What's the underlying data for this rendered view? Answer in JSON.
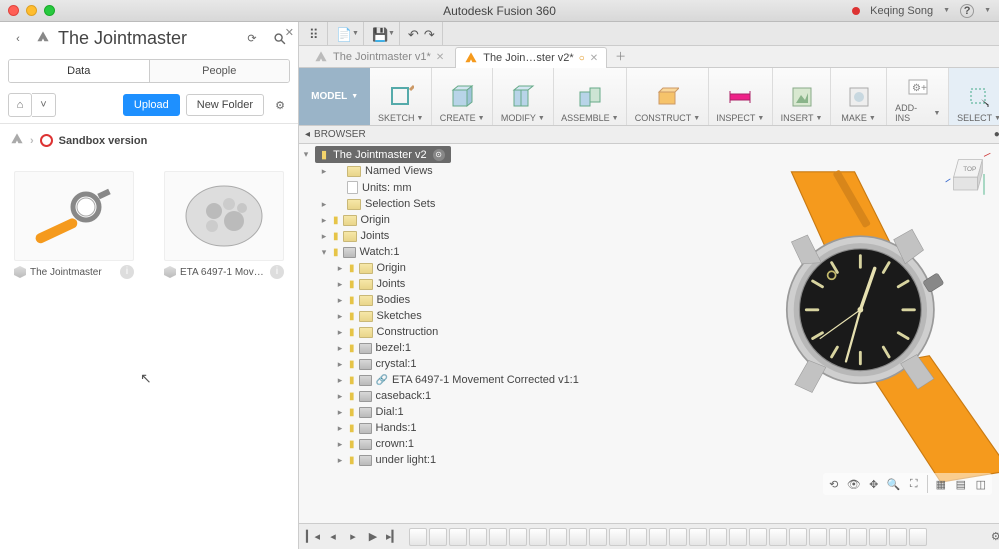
{
  "app_title": "Autodesk Fusion 360",
  "user_name": "Keqing Song",
  "left_panel": {
    "title": "The Jointmaster",
    "tabs": {
      "data": "Data",
      "people": "People",
      "active": "data"
    },
    "upload": "Upload",
    "new_folder": "New Folder",
    "sandbox": "Sandbox version",
    "thumbs": [
      {
        "name": "The Jointmaster"
      },
      {
        "name": "ETA 6497-1 Move…"
      }
    ]
  },
  "doc_tabs": [
    {
      "name": "The Jointmaster v1*",
      "active": false,
      "dirty": true
    },
    {
      "name": "The Join…ster v2*",
      "active": true,
      "dirty": true
    }
  ],
  "ribbon": {
    "workspace": "MODEL",
    "groups": [
      "SKETCH",
      "CREATE",
      "MODIFY",
      "ASSEMBLE",
      "CONSTRUCT",
      "INSPECT",
      "INSERT",
      "MAKE",
      "ADD-INS",
      "SELECT"
    ],
    "active": "SELECT"
  },
  "browser": {
    "label": "BROWSER",
    "root": "The Jointmaster v2",
    "items": [
      {
        "label": "Named Views",
        "depth": 0,
        "exp": "▸",
        "icon": "fold"
      },
      {
        "label": "Units: mm",
        "depth": 0,
        "exp": "",
        "icon": "doc"
      },
      {
        "label": "Selection Sets",
        "depth": 0,
        "exp": "▸",
        "icon": "fold"
      },
      {
        "label": "Origin",
        "depth": 0,
        "exp": "▸",
        "icon": "fold",
        "bulb": true
      },
      {
        "label": "Joints",
        "depth": 0,
        "exp": "▸",
        "icon": "fold",
        "bulb": true
      },
      {
        "label": "Watch:1",
        "depth": 0,
        "exp": "▾",
        "icon": "comp",
        "bulb": true
      },
      {
        "label": "Origin",
        "depth": 1,
        "exp": "▸",
        "icon": "fold",
        "bulb": true
      },
      {
        "label": "Joints",
        "depth": 1,
        "exp": "▸",
        "icon": "fold",
        "bulb": true
      },
      {
        "label": "Bodies",
        "depth": 1,
        "exp": "▸",
        "icon": "fold",
        "bulb": true
      },
      {
        "label": "Sketches",
        "depth": 1,
        "exp": "▸",
        "icon": "fold",
        "bulb": true
      },
      {
        "label": "Construction",
        "depth": 1,
        "exp": "▸",
        "icon": "fold",
        "bulb": true
      },
      {
        "label": "bezel:1",
        "depth": 1,
        "exp": "▸",
        "icon": "comp",
        "bulb": true
      },
      {
        "label": "crystal:1",
        "depth": 1,
        "exp": "▸",
        "icon": "comp",
        "bulb": true
      },
      {
        "label": "ETA 6497-1 Movement Corrected v1:1",
        "depth": 1,
        "exp": "▸",
        "icon": "comp",
        "bulb": true,
        "link": true
      },
      {
        "label": "caseback:1",
        "depth": 1,
        "exp": "▸",
        "icon": "comp",
        "bulb": true
      },
      {
        "label": "Dial:1",
        "depth": 1,
        "exp": "▸",
        "icon": "comp",
        "bulb": true
      },
      {
        "label": "Hands:1",
        "depth": 1,
        "exp": "▸",
        "icon": "comp",
        "bulb": true
      },
      {
        "label": "crown:1",
        "depth": 1,
        "exp": "▸",
        "icon": "comp",
        "bulb": true
      },
      {
        "label": "under light:1",
        "depth": 1,
        "exp": "▸",
        "icon": "comp",
        "bulb": true
      }
    ]
  },
  "viewcube_face": "TOP",
  "timeline_chips": 26
}
